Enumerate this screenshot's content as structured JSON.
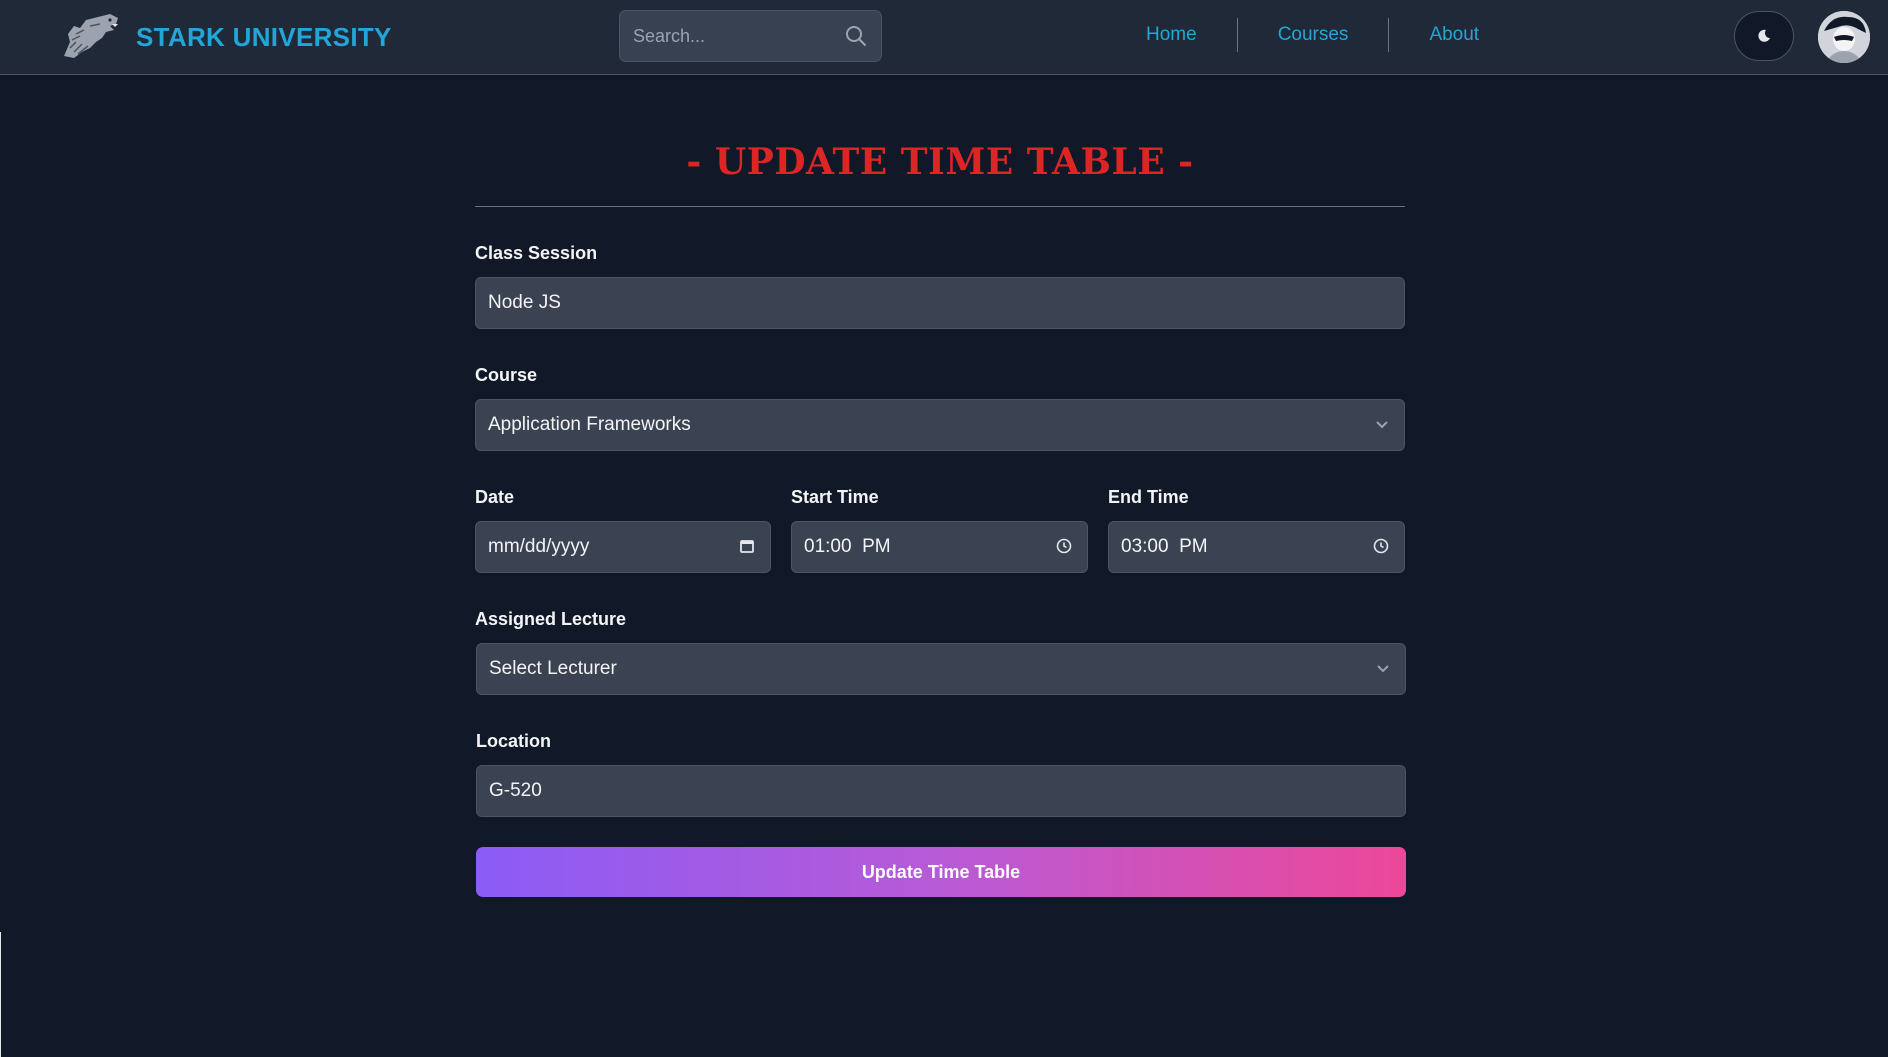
{
  "header": {
    "brand_name": "STARK UNIVERSITY",
    "search_placeholder": "Search...",
    "nav": [
      {
        "label": "Home"
      },
      {
        "label": "Courses"
      },
      {
        "label": "About"
      }
    ],
    "theme_icon": "moon-icon",
    "avatar_icon": "user-avatar"
  },
  "page": {
    "title": "- UPDATE TIME TABLE -"
  },
  "form": {
    "class_session": {
      "label": "Class Session",
      "value": "Node JS"
    },
    "course": {
      "label": "Course",
      "value": "Application Frameworks"
    },
    "date": {
      "label": "Date",
      "value": "mm/dd/yyyy"
    },
    "start_time": {
      "label": "Start Time",
      "value": "01:00  PM"
    },
    "end_time": {
      "label": "End Time",
      "value": "03:00  PM"
    },
    "lecturer": {
      "label": "Assigned Lecture",
      "value": "Select Lecturer"
    },
    "location": {
      "label": "Location",
      "value": "G-520"
    },
    "submit_label": "Update Time Table"
  },
  "colors": {
    "background": "#111827",
    "navbar": "#1f2937",
    "brand": "#22a6d8",
    "title": "#dc2626",
    "input_bg": "#3b4252",
    "button_gradient_start": "#8b5cf6",
    "button_gradient_end": "#ec4899"
  }
}
